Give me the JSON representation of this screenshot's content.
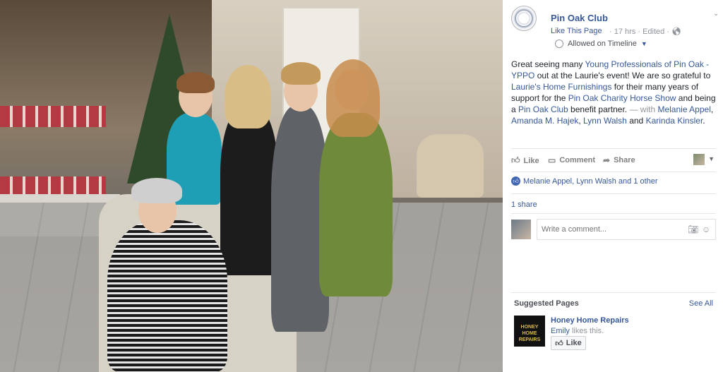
{
  "page": {
    "name": "Pin Oak Club",
    "like_this_page": "Like This Page",
    "meta": "· 17 hrs · Edited ·",
    "timeline": "Allowed on Timeline"
  },
  "post": {
    "t1": "Great seeing many ",
    "l1": "Young Professionals of Pin Oak - YPPO",
    "t2": " out at the Laurie's event! We are so grateful to ",
    "l2": "Laurie's Home Furnishings",
    "t3": " for their many years of support for the ",
    "l3": "Pin Oak Charity Horse Show",
    "t4": " and being a ",
    "l4": "Pin Oak Club",
    "t5": " benefit partner.",
    "with": " — with",
    "tag1": "Melanie Appel",
    "tag2": "Amanda M. Hajek",
    "tag3": "Lynn Walsh",
    "and": " and",
    "tag4": "Karinda Kinsler",
    "end": "."
  },
  "actions": {
    "like": "Like",
    "comment": "Comment",
    "share": "Share"
  },
  "reactions": {
    "text": "Melanie Appel, Lynn Walsh and 1 other"
  },
  "shares": "1 share",
  "comment": {
    "placeholder": "Write a comment..."
  },
  "suggested": {
    "heading": "Suggested Pages",
    "see_all": "See All",
    "thumb_text": "HONEY HOME REPAIRS",
    "name": "Honey Home Repairs",
    "liker": "Emily",
    "likes_this": " likes this.",
    "like_button": "Like"
  },
  "colors": {
    "link": "#365899",
    "like_blue": "#4267b2",
    "muted": "#90949c"
  }
}
